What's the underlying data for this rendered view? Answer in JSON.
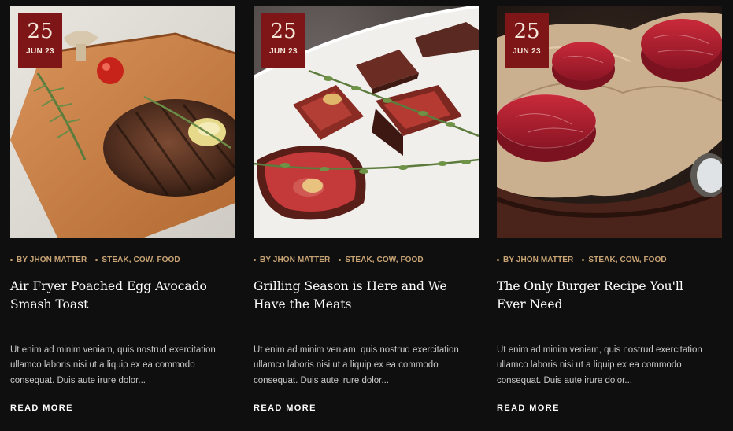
{
  "posts": [
    {
      "date": {
        "day": "25",
        "month": "JUN 23"
      },
      "author": "BY JHON MATTER",
      "tags": "STEAK, COW, FOOD",
      "title_line1": "Air Fryer Poached Egg Avocado",
      "title_line2": "Smash Toast",
      "excerpt": "Ut enim ad minim veniam, quis nostrud exercitation ullamco laboris nisi ut a liquip ex ea commodo consequat. Duis aute irure dolor...",
      "read_more": "READ MORE",
      "image": "grilled-steak-on-board"
    },
    {
      "date": {
        "day": "25",
        "month": "JUN 23"
      },
      "author": "BY JHON MATTER",
      "tags": "STEAK, COW, FOOD",
      "title_line1": "Grilling Season is Here and We",
      "title_line2": "Have the Meats",
      "excerpt": "Ut enim ad minim veniam, quis nostrud exercitation ullamco laboris nisi ut a liquip ex ea commodo consequat. Duis aute irure dolor...",
      "read_more": "READ MORE",
      "image": "sliced-steak-plate"
    },
    {
      "date": {
        "day": "25",
        "month": "JUN 23"
      },
      "author": "BY JHON MATTER",
      "tags": "STEAK, COW, FOOD",
      "title_line1": "The Only Burger Recipe You'll",
      "title_line2": "Ever Need",
      "excerpt": "Ut enim ad minim veniam, quis nostrud exercitation ullamco laboris nisi ut a liquip ex ea commodo consequat. Duis aute irure dolor...",
      "read_more": "READ MORE",
      "image": "raw-fillets-on-paper"
    }
  ],
  "colors": {
    "background": "#0f0f10",
    "date_badge": "#7e1516",
    "meta_accent": "#c9a474",
    "active_rule": "#d9c3a6"
  }
}
